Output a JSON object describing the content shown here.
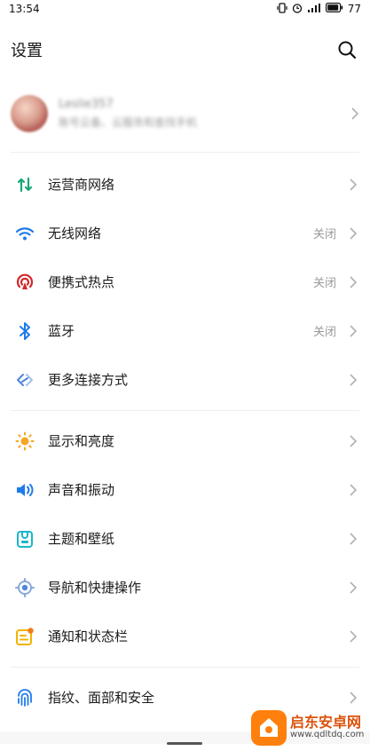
{
  "status_bar": {
    "time": "13:54",
    "battery": "77",
    "icons": [
      "vibrate-icon",
      "alarm-icon",
      "signal-icon",
      "battery-icon"
    ]
  },
  "header": {
    "title": "设置",
    "search_icon": "search-icon"
  },
  "profile": {
    "name": "Leslie357",
    "subtitle": "账号云备、云服务和查找手机"
  },
  "sections": [
    {
      "items": [
        {
          "icon": "mobile-network-icon",
          "label": "运营商网络",
          "value": "",
          "color": "#1aa67a"
        },
        {
          "icon": "wifi-icon",
          "label": "无线网络",
          "value": "关闭",
          "color": "#1e7be8"
        },
        {
          "icon": "hotspot-icon",
          "label": "便携式热点",
          "value": "关闭",
          "color": "#d2282a"
        },
        {
          "icon": "bluetooth-icon",
          "label": "蓝牙",
          "value": "关闭",
          "color": "#1e7be8"
        },
        {
          "icon": "more-connections-icon",
          "label": "更多连接方式",
          "value": "",
          "color": "#4f86d9"
        }
      ]
    },
    {
      "items": [
        {
          "icon": "brightness-icon",
          "label": "显示和亮度",
          "value": "",
          "color": "#f5a623"
        },
        {
          "icon": "sound-icon",
          "label": "声音和振动",
          "value": "",
          "color": "#1e7be8"
        },
        {
          "icon": "theme-icon",
          "label": "主题和壁纸",
          "value": "",
          "color": "#1ab6c9"
        },
        {
          "icon": "navigation-icon",
          "label": "导航和快捷操作",
          "value": "",
          "color": "#4f86d9"
        },
        {
          "icon": "notification-icon",
          "label": "通知和状态栏",
          "value": "",
          "color": "#f0b400"
        }
      ]
    },
    {
      "items": [
        {
          "icon": "fingerprint-icon",
          "label": "指纹、面部和安全",
          "value": "",
          "color": "#1e7be8"
        }
      ]
    }
  ],
  "watermark": {
    "name": "启东安卓网",
    "url": "www.qdltdq.com"
  }
}
